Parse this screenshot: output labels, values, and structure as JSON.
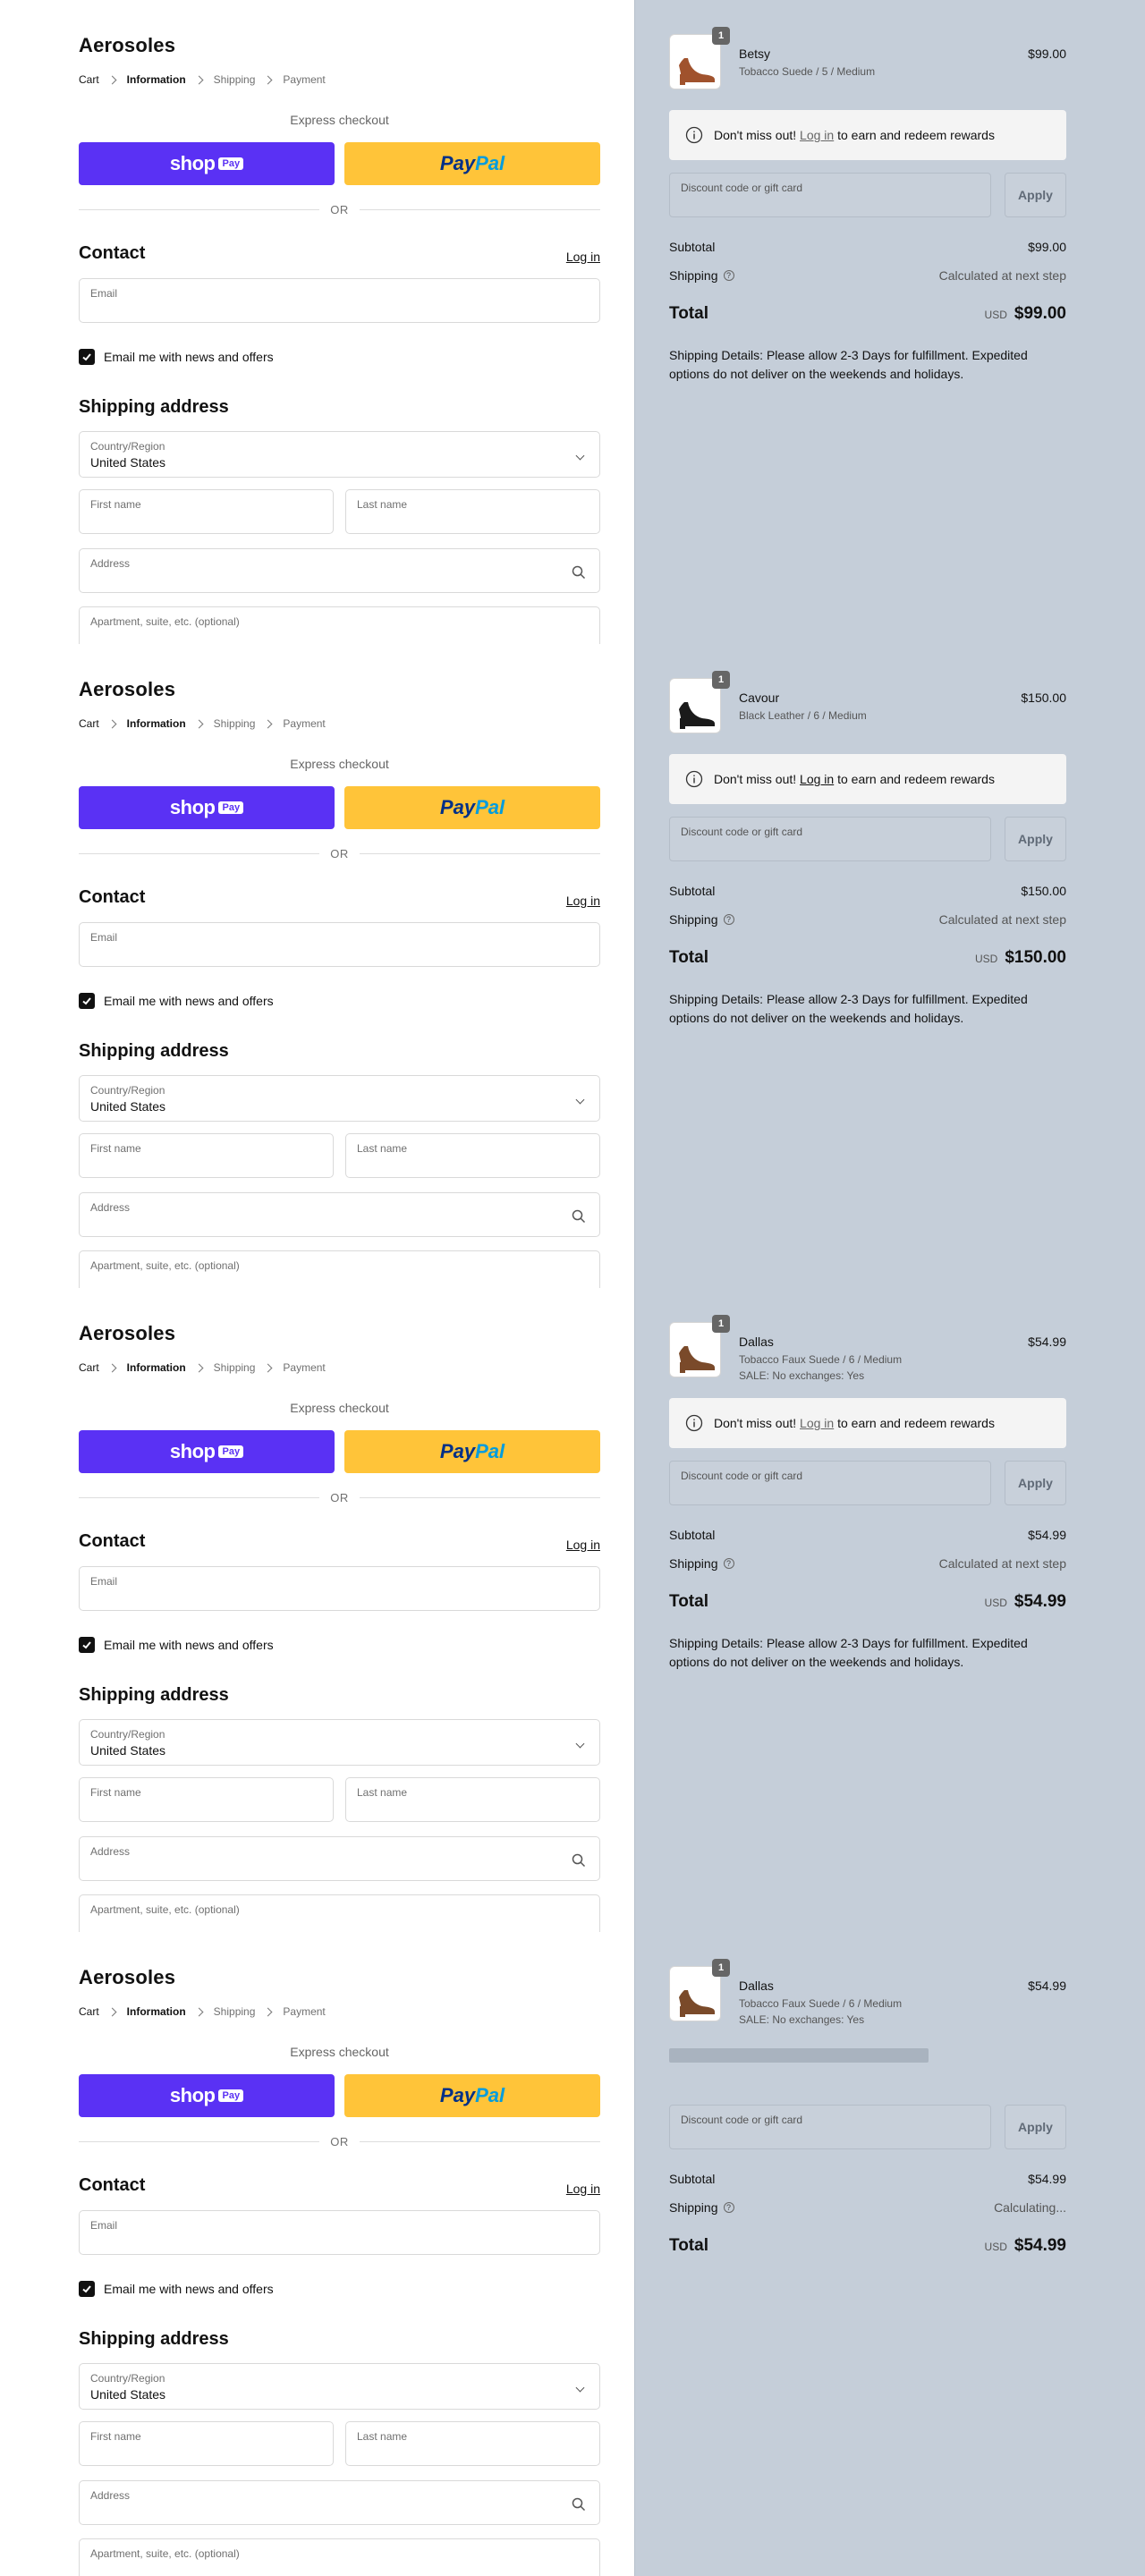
{
  "checkout": {
    "brand": "Aerosoles",
    "breadcrumb": [
      "Cart",
      "Information",
      "Shipping",
      "Payment"
    ],
    "express_label": "Express checkout",
    "shop_pay": {
      "word": "shop",
      "badge": "Pay"
    },
    "paypal": {
      "part1": "Pay",
      "part2": "Pal"
    },
    "or_label": "OR",
    "contact_heading": "Contact",
    "login_label": "Log in",
    "email_placeholder": "Email",
    "news_label": "Email me with news and offers",
    "news_checked": true,
    "shipping_heading": "Shipping address",
    "country_label": "Country/Region",
    "country_value": "United States",
    "first_name_placeholder": "First name",
    "last_name_placeholder": "Last name",
    "address_placeholder": "Address",
    "apartment_placeholder": "Apartment, suite, etc. (optional)"
  },
  "summary_common": {
    "rewards_pre": "Don't miss out!",
    "rewards_link": "Log in",
    "rewards_post": "to earn and redeem rewards",
    "discount_placeholder": "Discount code or gift card",
    "apply_label": "Apply",
    "subtotal_label": "Subtotal",
    "shipping_label": "Shipping",
    "shipping_info_icon": "?",
    "total_label": "Total",
    "currency": "USD",
    "shipping_note": "Shipping Details: Please allow 2-3 Days for fulfillment. Expedited options do not deliver on the weekends and holidays."
  },
  "panels": [
    {
      "product": {
        "qty": "1",
        "name": "Betsy",
        "variant": "Tobacco Suede / 5 / Medium",
        "note": "",
        "price": "$99.00",
        "color": "#a0522d"
      },
      "rewards_link_style": "gray",
      "subtotal": "$99.00",
      "shipping_value": "Calculated at next step",
      "total": "$99.00",
      "loading": false
    },
    {
      "product": {
        "qty": "1",
        "name": "Cavour",
        "variant": "Black Leather / 6 / Medium",
        "note": "",
        "price": "$150.00",
        "color": "#1a1a1a"
      },
      "rewards_link_style": "dark",
      "subtotal": "$150.00",
      "shipping_value": "Calculated at next step",
      "total": "$150.00",
      "loading": false
    },
    {
      "product": {
        "qty": "1",
        "name": "Dallas",
        "variant": "Tobacco Faux Suede / 6 / Medium",
        "note": "SALE: No exchanges: Yes",
        "price": "$54.99",
        "color": "#7a4a2a"
      },
      "rewards_link_style": "gray",
      "subtotal": "$54.99",
      "shipping_value": "Calculated at next step",
      "total": "$54.99",
      "loading": false
    },
    {
      "product": {
        "qty": "1",
        "name": "Dallas",
        "variant": "Tobacco Faux Suede / 6 / Medium",
        "note": "SALE: No exchanges: Yes",
        "price": "$54.99",
        "color": "#7a4a2a"
      },
      "rewards_link_style": "gray",
      "subtotal": "$54.99",
      "shipping_value": "Calculating...",
      "total": "$54.99",
      "loading": true
    }
  ]
}
